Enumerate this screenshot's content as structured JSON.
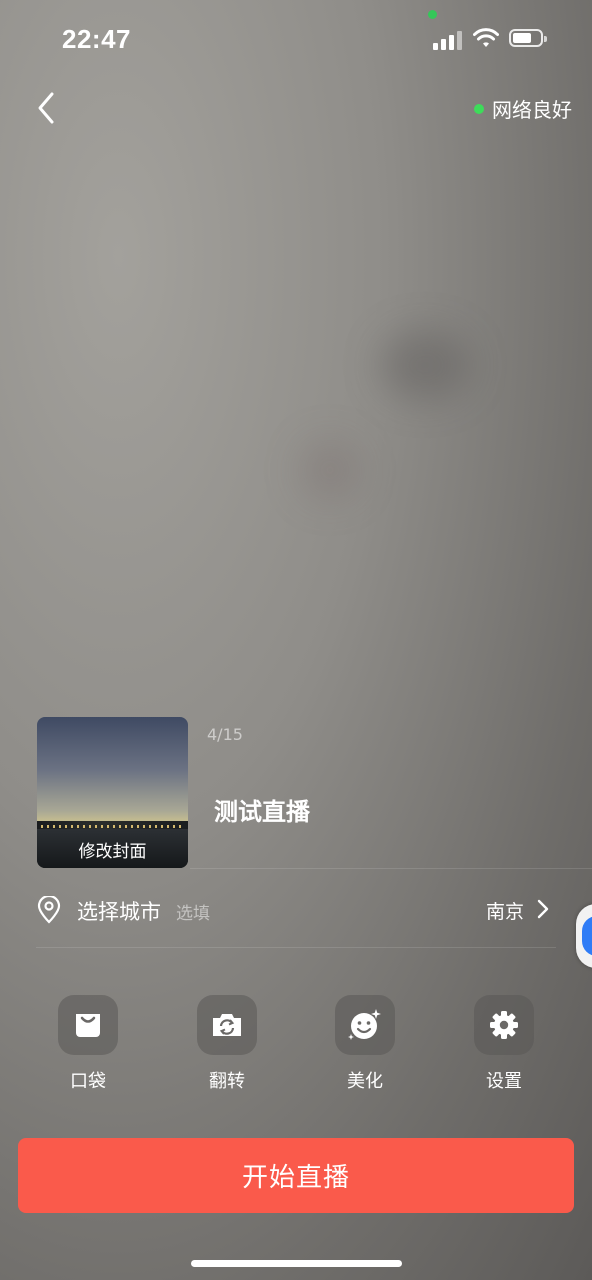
{
  "status_bar": {
    "time": "22:47",
    "camera_indicator_color": "#34c759",
    "icons": [
      "signal-icon",
      "wifi-icon",
      "battery-icon"
    ]
  },
  "header": {
    "back_icon": "chevron-left-icon",
    "network_status": "网络良好",
    "network_dot_color": "#3ddc5a"
  },
  "cover": {
    "label": "修改封面"
  },
  "title": {
    "char_count": "4/15",
    "value": "测试直播"
  },
  "city": {
    "icon": "location-pin-icon",
    "label": "选择城市",
    "optional_hint": "选填",
    "value": "南京",
    "chevron_icon": "chevron-right-icon"
  },
  "tools": [
    {
      "label": "口袋",
      "icon": "bag-icon"
    },
    {
      "label": "翻转",
      "icon": "camera-flip-icon"
    },
    {
      "label": "美化",
      "icon": "beauty-face-icon"
    },
    {
      "label": "设置",
      "icon": "gear-icon"
    }
  ],
  "start_button": {
    "label": "开始直播",
    "color": "#fa5a4b"
  }
}
